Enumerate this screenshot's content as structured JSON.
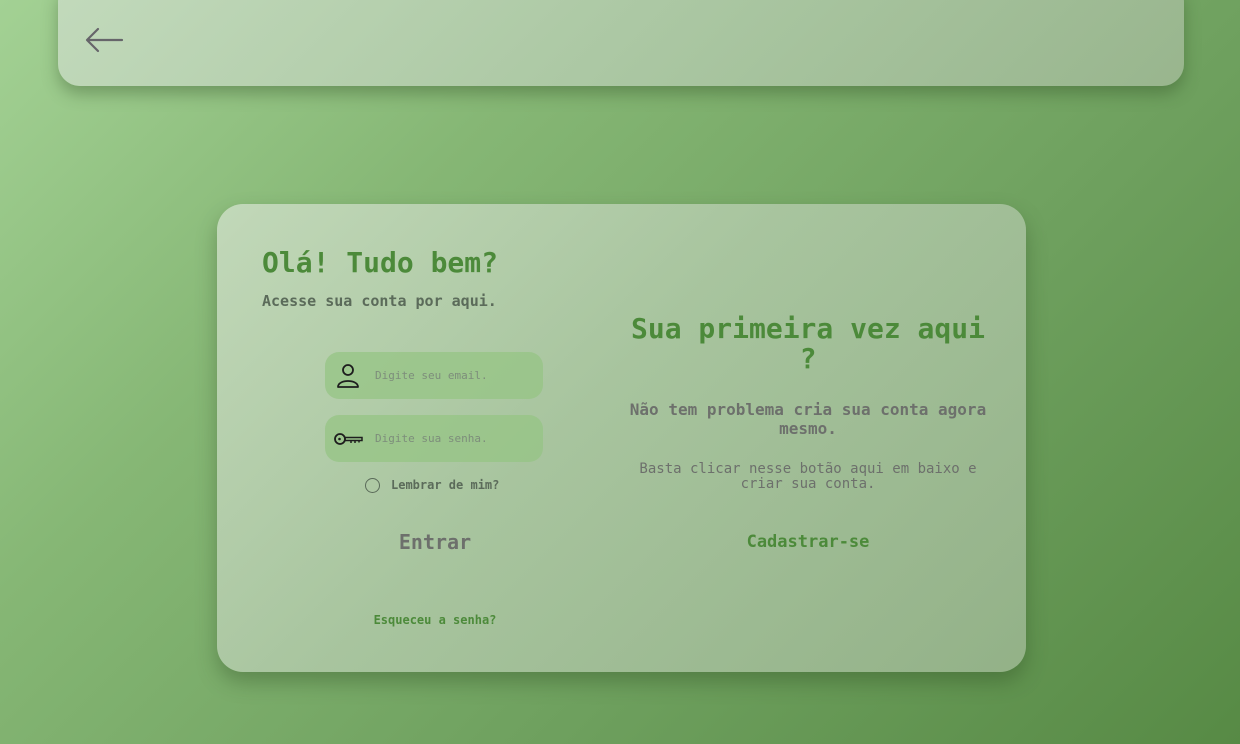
{
  "header": {
    "back_icon": "arrow-left-icon"
  },
  "login": {
    "title": "Olá! Tudo bem?",
    "subtitle": "Acesse sua conta por aqui.",
    "email_placeholder": "Digite seu email.",
    "email_icon": "user-icon",
    "password_placeholder": "Digite sua senha.",
    "password_icon": "key-icon",
    "remember_label": "Lembrar de mim?",
    "remember_checked": false,
    "submit_label": "Entrar",
    "forgot_label": "Esqueceu a senha?"
  },
  "signup": {
    "title": "Sua primeira vez aqui ?",
    "subtitle": "Não tem problema cria sua conta agora mesmo.",
    "text": "Basta clicar nesse botão aqui em baixo e criar sua conta.",
    "button_label": "Cadastrar-se"
  },
  "colors": {
    "accent": "#4c8a3a",
    "text_muted": "#6d706c",
    "field_bg": "#96c484"
  }
}
